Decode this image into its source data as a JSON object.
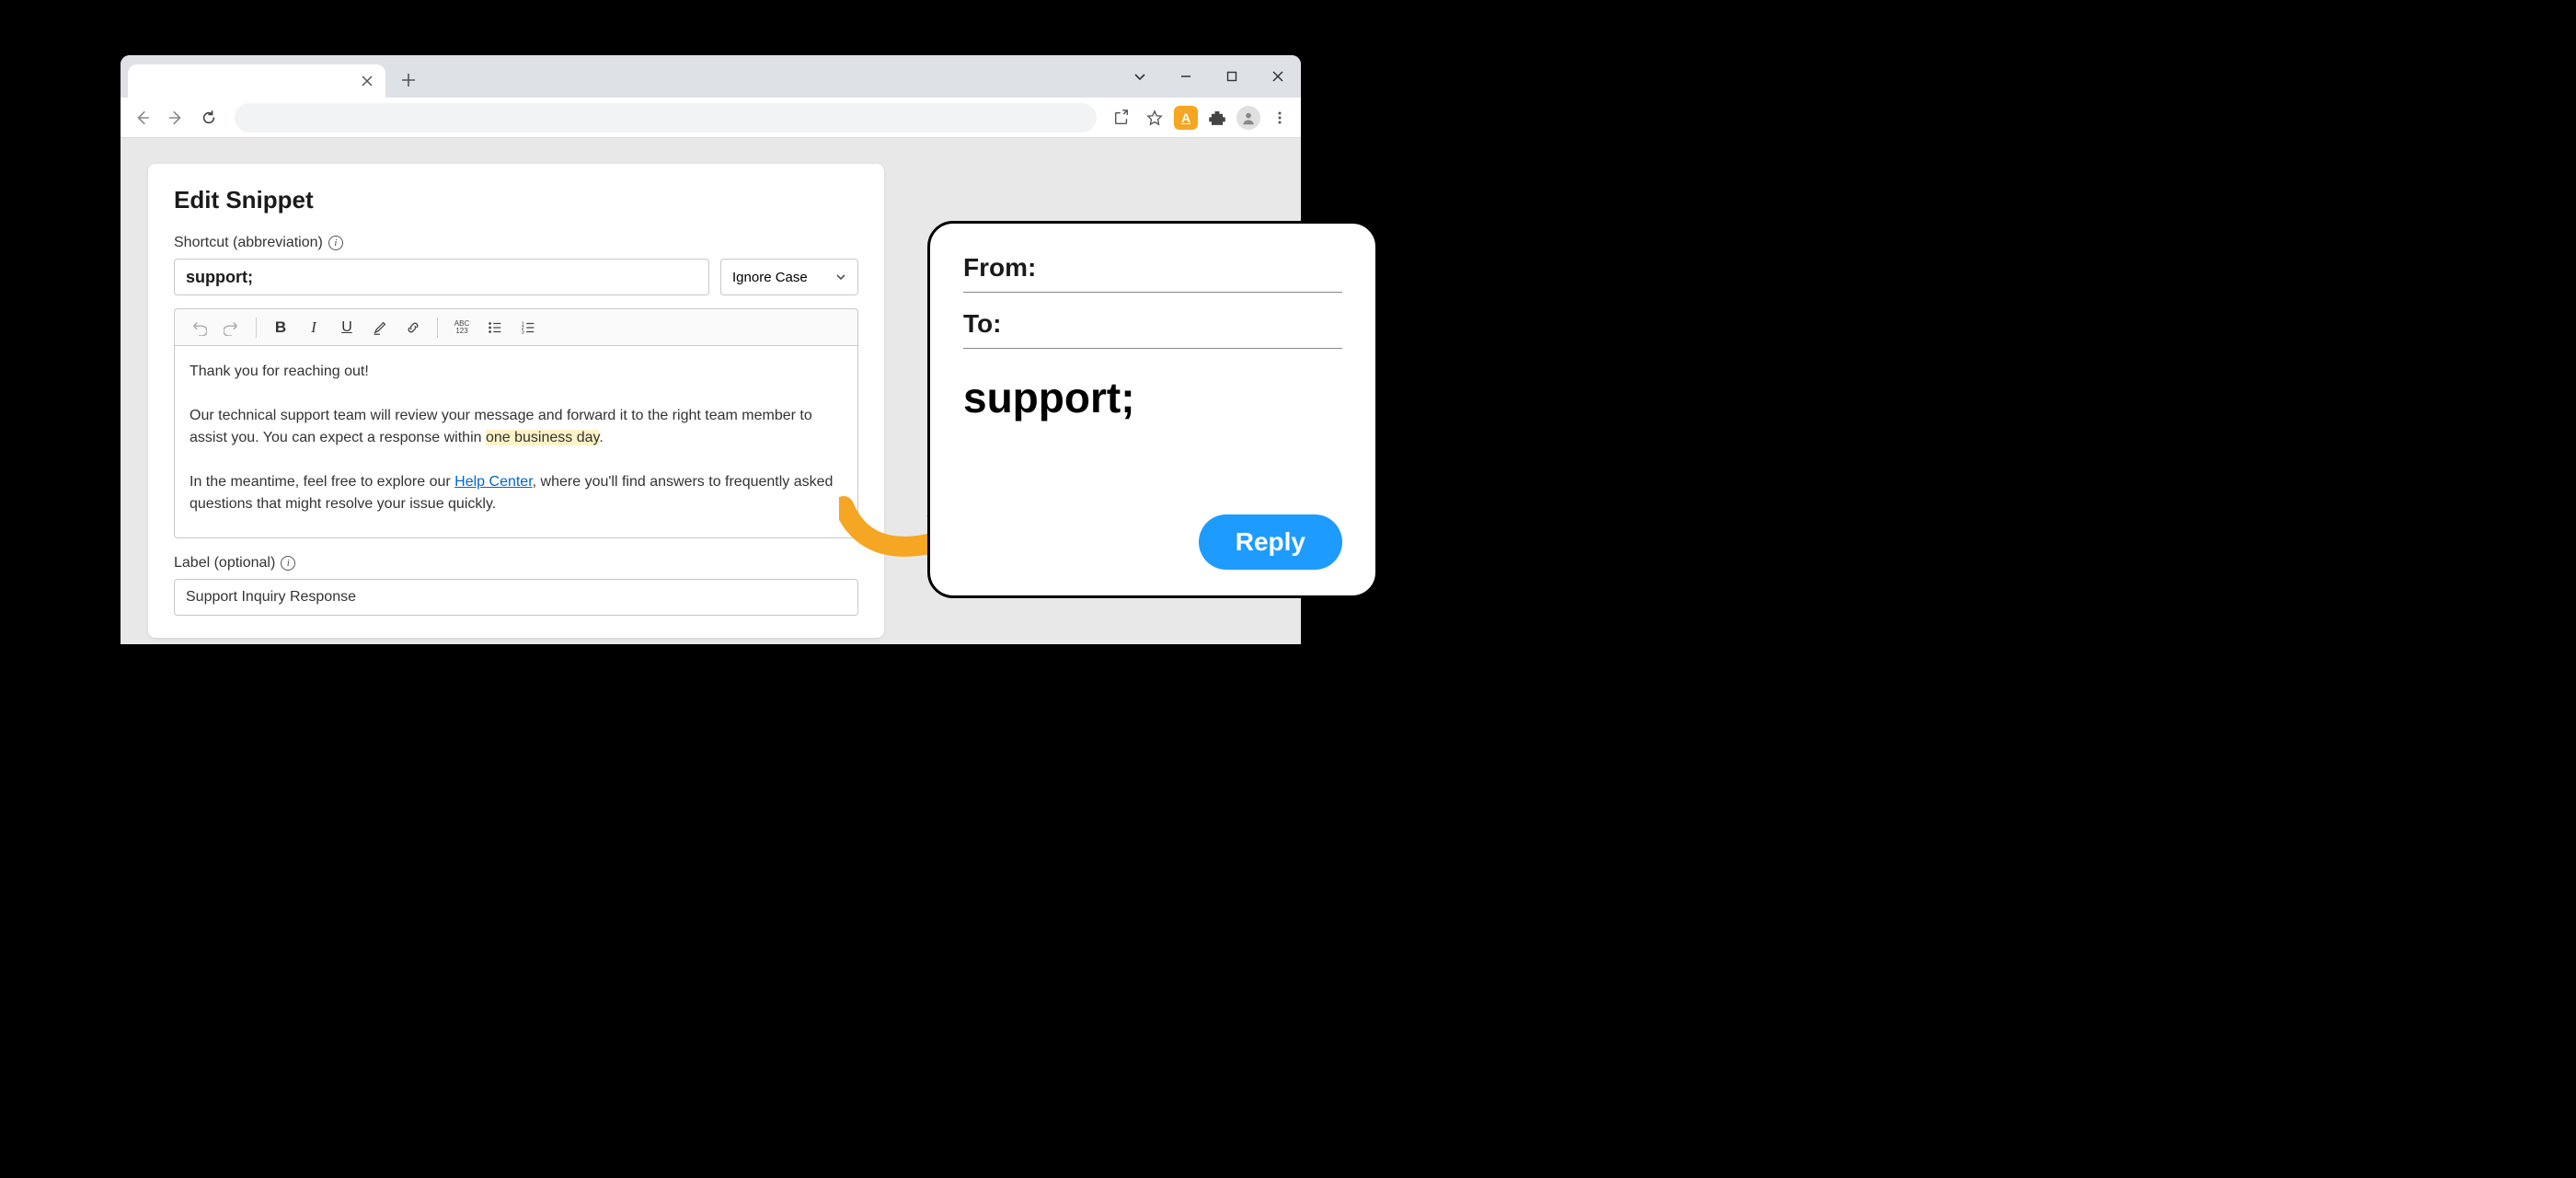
{
  "browser": {
    "win_controls": {
      "min": "−",
      "max": "□",
      "close": "✕"
    }
  },
  "snippet": {
    "title": "Edit Snippet",
    "shortcut_label": "Shortcut (abbreviation)",
    "shortcut_value": "support;",
    "case_option": "Ignore Case",
    "editor": {
      "p1": "Thank you for reaching out!",
      "p2a": "Our technical support team will review your message and forward it to the right team member to assist you. You can expect a response within ",
      "p2_highlight": "one business day",
      "p2b": ".",
      "p3a": "In the meantime, feel free to explore our ",
      "p3_link": "Help Center",
      "p3b": ", where you'll find answers to frequently asked questions that might resolve your issue quickly."
    },
    "label_label": "Label (optional)",
    "label_value": "Support Inquiry Response"
  },
  "email": {
    "from_label": "From:",
    "to_label": "To:",
    "compose_text": "support;",
    "reply_label": "Reply"
  },
  "icons": {
    "ext_letter": "A",
    "abc123": "ABC\n123"
  }
}
